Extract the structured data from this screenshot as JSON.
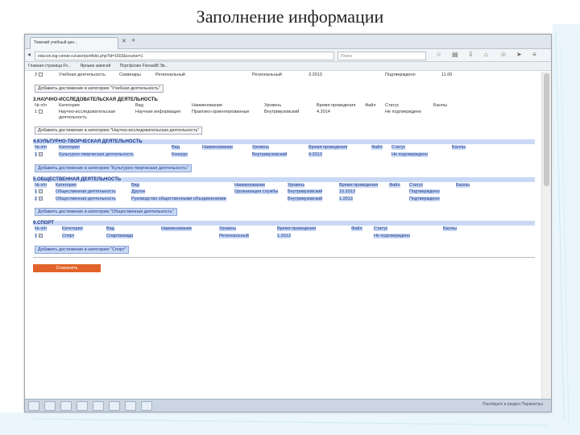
{
  "slide": {
    "title": "Заполнение информации"
  },
  "browser": {
    "tab_label": "Томский учебный цен...",
    "url": "educon.tsg-center.ru/user/portfolio.php?id=1603&course=1",
    "search_placeholder": "Поиск",
    "bookmarks": [
      "Главная страница Fir...",
      "Ярлыки записей",
      "Портфолио Fiveas88 Эв..."
    ]
  },
  "sections": {
    "row_top": {
      "cells": [
        "3",
        "Учебная деятельность",
        "Семинары",
        "Региональный",
        "Региональный",
        "3.2013",
        "Подтверждено",
        "11.00"
      ]
    },
    "add_study": "Добавить достижение в категорию \"Учебная деятельность\"",
    "research": {
      "title": "3.НАУЧНО-ИССЛЕДОВАТЕЛЬСКАЯ ДЕЯТЕЛЬНОСТЬ",
      "headers": [
        "№ п/п",
        "Категория",
        "Вид",
        "Наименование",
        "Уровень",
        "Время проведения",
        "Файл",
        "Статус",
        "Баллы"
      ],
      "row": [
        "1",
        "Научно-исследовательская деятельность",
        "Научная информация",
        "Практико-ориентированные",
        "Внутривузовский",
        "4.2014",
        "",
        "Не подтверждено",
        ""
      ],
      "add": "Добавить достижение в категорию \"Научно-исследовательская деятельность\""
    },
    "creative": {
      "title": "4.КУЛЬТУРНО-ТВОРЧЕСКАЯ ДЕЯТЕЛЬНОСТЬ",
      "headers": [
        "№ п/п",
        "Категория",
        "Вид",
        "Наименование",
        "Уровень",
        "Время проведения",
        "Файл",
        "Статус",
        "Баллы"
      ],
      "row": [
        "1",
        "Культурно-творческая деятельность",
        "Конкурс",
        "",
        "Внутривузовский",
        "4.2013",
        "",
        "Не подтверждено",
        ""
      ],
      "add": "Добавить достижение в категорию \"Культурно-творческая деятельность\""
    },
    "social": {
      "title": "5.ОБЩЕСТВЕННАЯ ДЕЯТЕЛЬНОСТЬ",
      "headers": [
        "№ п/п",
        "Категория",
        "Вид",
        "Наименование",
        "Уровень",
        "Время проведения",
        "Файл",
        "Статус",
        "Баллы"
      ],
      "rows": [
        [
          "1",
          "Общественная деятельность",
          "Другое",
          "Организация службы",
          "Внутривузовский",
          "10.2013",
          "",
          "Подтверждено",
          ""
        ],
        [
          "2",
          "Общественная деятельность",
          "Руководство общественными объединениями",
          "",
          "Внутривузовский",
          "1.2013",
          "",
          "Подтверждено",
          ""
        ]
      ],
      "add": "Добавить достижение в категорию \"Общественная деятельность\""
    },
    "sport": {
      "title": "6.СПОРТ",
      "headers": [
        "№ п/п",
        "Категория",
        "Вид",
        "Наименование",
        "Уровень",
        "Время проведения",
        "Файл",
        "Статус",
        "Баллы"
      ],
      "row": [
        "1",
        "Спорт",
        "Спартакиада",
        "",
        "Региональный",
        "1.2013",
        "",
        "Не подтверждено",
        ""
      ],
      "add": "Добавить достижение в категорию \"Спорт\""
    },
    "save": "Сохранить"
  },
  "taskbar": {
    "text": "Перейдите в раздел Параметры"
  }
}
